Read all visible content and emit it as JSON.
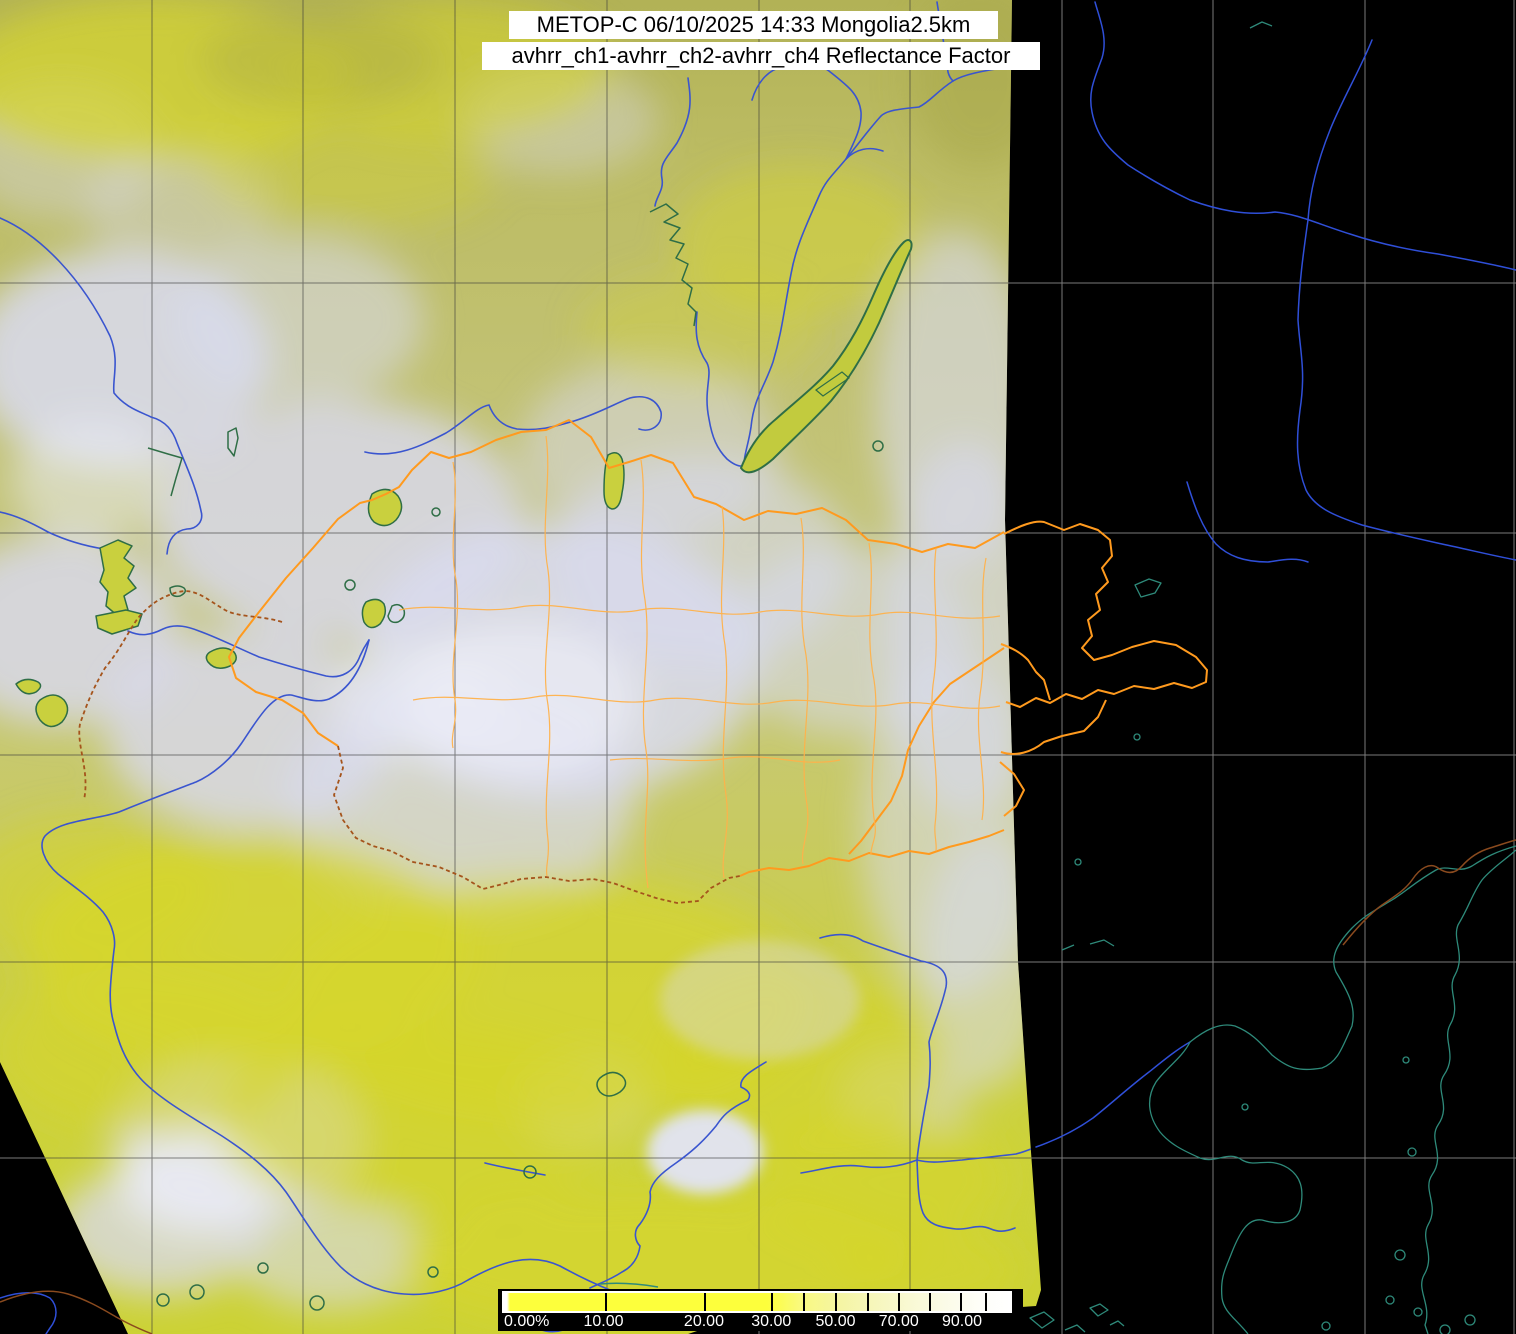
{
  "header": {
    "line1": "METOP-C 06/10/2025 14:33 Mongolia2.5km",
    "line2": "avhrr_ch1-avhrr_ch2-avhrr_ch4 Reflectance Factor"
  },
  "colorbar": {
    "unit": "%",
    "min": 0,
    "max": 100,
    "labels": [
      {
        "text": "0.00%",
        "frac": 0.004,
        "align": "left"
      },
      {
        "text": "10.00",
        "frac": 0.199,
        "align": "center"
      },
      {
        "text": "20.00",
        "frac": 0.396,
        "align": "center"
      },
      {
        "text": "30.00",
        "frac": 0.528,
        "align": "center"
      },
      {
        "text": "50.00",
        "frac": 0.654,
        "align": "center"
      },
      {
        "text": "70.00",
        "frac": 0.778,
        "align": "center"
      },
      {
        "text": "90.00",
        "frac": 0.902,
        "align": "center"
      }
    ],
    "ticks": [
      0.199,
      0.396,
      0.528,
      0.591,
      0.654,
      0.717,
      0.778,
      0.839,
      0.902,
      0.951
    ],
    "scale_colors": {
      "low": "#fdff3c",
      "mid": "#f6f6b0",
      "high": "#ffffff"
    }
  },
  "map": {
    "satellite": "METOP-C",
    "region": "Mongolia",
    "colors": {
      "space_background": "#000000",
      "graticule_on_black": "#7a7a7a",
      "graticule_on_image": "#3a3a3a",
      "river_blue": "#3a55cf",
      "river_blue_space": "#2f4fd8",
      "lake_green": "#2f6e46",
      "lake_fill": "#c9d03e",
      "coast_teal": "#2e8a7a",
      "border_orange": "#ff9a1e",
      "border_province_orange": "#ffb24a",
      "border_brown": "#a5541c",
      "terrain_olive": "#b9b957",
      "terrain_yellow": "#cdd53a",
      "cloud_lavender": "#d9daf0"
    }
  }
}
